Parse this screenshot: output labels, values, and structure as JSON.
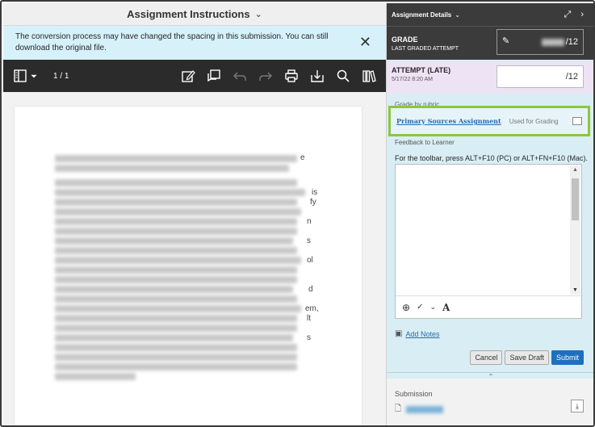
{
  "left": {
    "title": "Assignment Instructions",
    "notice": "The conversion process may have changed the spacing in this submission. You can still download the original file.",
    "toolbar": {
      "page": "1 / 1"
    },
    "doc_fragments": [
      "e",
      "is",
      "fy",
      "n",
      "s",
      "ol",
      "d",
      "em,",
      "lt",
      "s"
    ]
  },
  "right": {
    "header": "Assignment Details",
    "grade": {
      "label": "GRADE",
      "sub": "LAST GRADED ATTEMPT",
      "max": "/12"
    },
    "attempt": {
      "label": "ATTEMPT (LATE)",
      "date": "5/17/22 8:20 AM",
      "max": "/12"
    },
    "rubric": {
      "section": "Grade by rubric",
      "name": "Primary Sources Assignment",
      "status": "Used for Grading"
    },
    "feedback": {
      "label": "Feedback to Learner",
      "hint": "For the toolbar, press ALT+F10 (PC) or ALT+FN+F10 (Mac)."
    },
    "notes": {
      "label": "Add Notes"
    },
    "buttons": {
      "cancel": "Cancel",
      "save": "Save Draft",
      "submit": "Submit"
    },
    "submission": {
      "label": "Submission"
    }
  },
  "colors": {
    "accent": "#8dc63f",
    "primary": "#1d6fbf",
    "dark": "#3b3b3b"
  }
}
